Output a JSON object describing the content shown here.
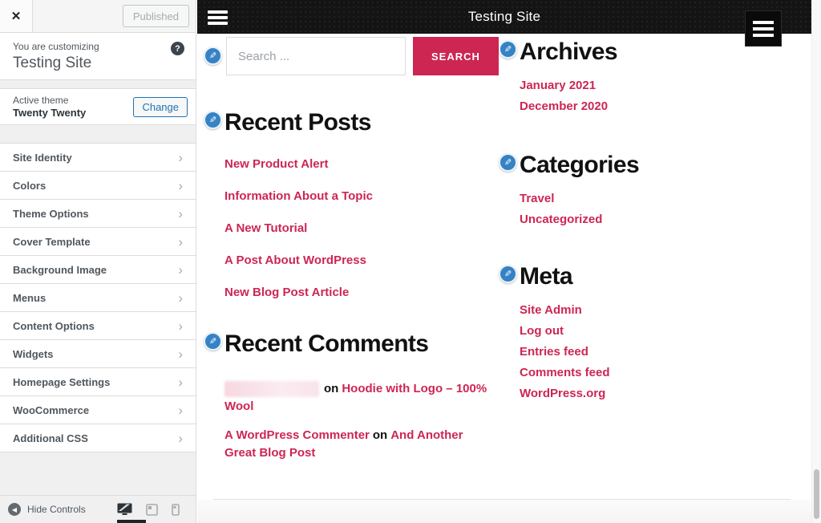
{
  "icons": {
    "close": "✕",
    "help": "?",
    "chevron": "›",
    "edit_pencil": "✎",
    "collapse_arrow": "◀"
  },
  "colors": {
    "accent_pink": "#cd2653",
    "edit_icon_blue": "#3582c4",
    "wp_blue": "#2271b1",
    "header_black": "#141414"
  },
  "customizer": {
    "publish_button": "Published",
    "customizing_label": "You are customizing",
    "site_title": "Testing Site",
    "active_theme_label": "Active theme",
    "theme_name": "Twenty Twenty",
    "change_button": "Change",
    "menu_items": [
      "Site Identity",
      "Colors",
      "Theme Options",
      "Cover Template",
      "Background Image",
      "Menus",
      "Content Options",
      "Widgets",
      "Homepage Settings",
      "WooCommerce",
      "Additional CSS"
    ],
    "hide_controls_label": "Hide Controls"
  },
  "preview": {
    "header_title": "Testing Site",
    "search": {
      "placeholder": "Search ...",
      "button_label": "SEARCH"
    },
    "recent_posts": {
      "title": "Recent Posts",
      "links": [
        "New Product Alert",
        "Information About a Topic",
        "A New Tutorial",
        "A Post About WordPress",
        "New Blog Post Article"
      ]
    },
    "recent_comments": {
      "title": "Recent Comments",
      "comments": [
        {
          "author": "",
          "author_redacted": true,
          "connector": "on",
          "post": "Hoodie with Logo – 100% Wool"
        },
        {
          "author": "A WordPress Commenter",
          "author_redacted": false,
          "connector": "on",
          "post": "And Another Great Blog Post"
        }
      ]
    },
    "archives": {
      "title": "Archives",
      "links": [
        "January 2021",
        "December 2020"
      ]
    },
    "categories": {
      "title": "Categories",
      "links": [
        "Travel",
        "Uncategorized"
      ]
    },
    "meta": {
      "title": "Meta",
      "links": [
        "Site Admin",
        "Log out",
        "Entries feed",
        "Comments feed",
        "WordPress.org"
      ]
    }
  }
}
